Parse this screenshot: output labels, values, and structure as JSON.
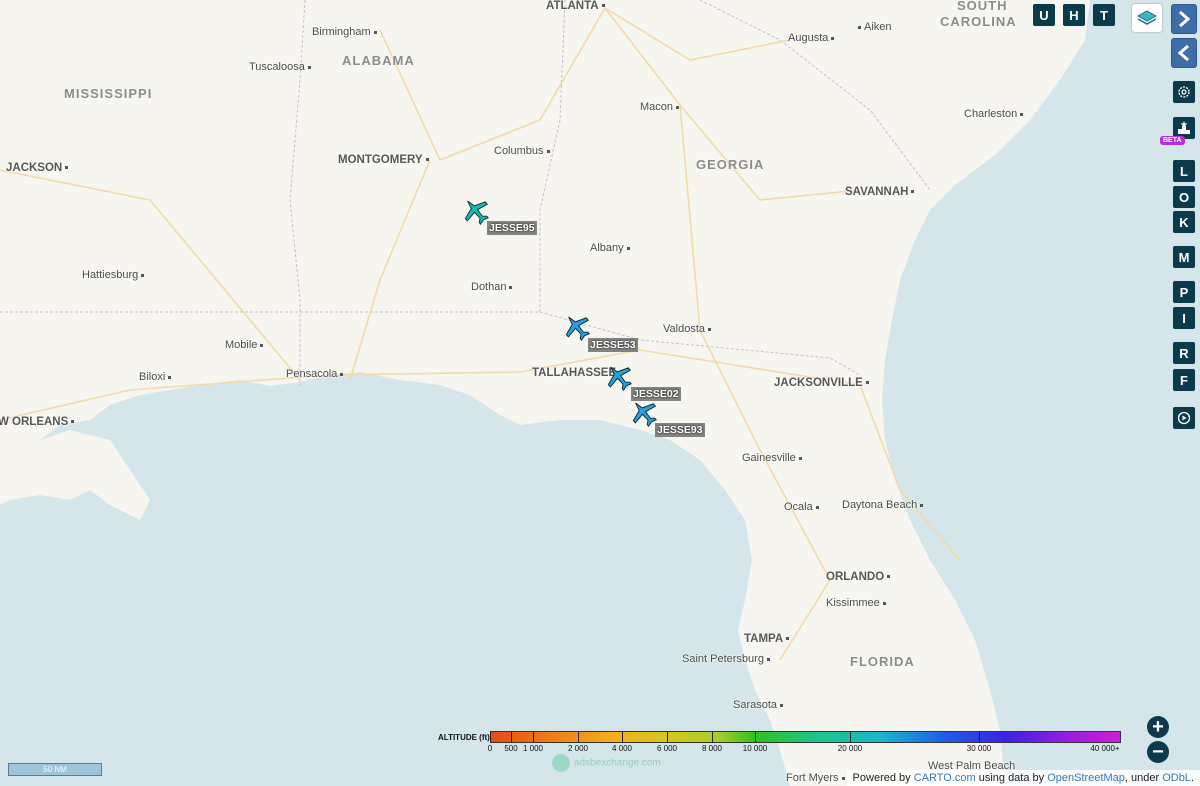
{
  "map": {
    "states": [
      {
        "name": "MISSISSIPPI"
      },
      {
        "name": "ALABAMA"
      },
      {
        "name": "GEORGIA"
      },
      {
        "name": "SOUTH"
      },
      {
        "name": "CAROLINA"
      },
      {
        "name": "FLORIDA"
      }
    ],
    "cities": [
      {
        "name": "ATLANTA",
        "major": true
      },
      {
        "name": "Birmingham"
      },
      {
        "name": "Tuscaloosa"
      },
      {
        "name": "Augusta"
      },
      {
        "name": "Aiken"
      },
      {
        "name": "Macon"
      },
      {
        "name": "Charleston"
      },
      {
        "name": "JACKSON",
        "major": true
      },
      {
        "name": "MONTGOMERY",
        "major": true
      },
      {
        "name": "Columbus"
      },
      {
        "name": "SAVANNAH",
        "major": true
      },
      {
        "name": "Albany"
      },
      {
        "name": "Hattiesburg"
      },
      {
        "name": "Dothan"
      },
      {
        "name": "Valdosta"
      },
      {
        "name": "Mobile"
      },
      {
        "name": "Pensacola"
      },
      {
        "name": "Biloxi"
      },
      {
        "name": "TALLAHASSEE",
        "major": true
      },
      {
        "name": "JACKSONVILLE",
        "major": true
      },
      {
        "name": "W ORLEANS",
        "major": true
      },
      {
        "name": "Gainesville"
      },
      {
        "name": "Ocala"
      },
      {
        "name": "Daytona Beach"
      },
      {
        "name": "ORLANDO",
        "major": true
      },
      {
        "name": "Kissimmee"
      },
      {
        "name": "TAMPA",
        "major": true
      },
      {
        "name": "Saint Petersburg"
      },
      {
        "name": "Sarasota"
      },
      {
        "name": "Fort Myers"
      },
      {
        "name": "West Palm Beach"
      }
    ]
  },
  "aircraft": [
    {
      "callsign": "JESSE95",
      "color": "#22b5b5"
    },
    {
      "callsign": "JESSE53",
      "color": "#2aa3dc"
    },
    {
      "callsign": "JESSE02",
      "color": "#2aa3dc"
    },
    {
      "callsign": "JESSE93",
      "color": "#2aa3dc"
    }
  ],
  "toolbar": {
    "top_buttons": [
      "U",
      "H",
      "T"
    ],
    "side_buttons": [
      "L",
      "O",
      "K",
      "M",
      "P",
      "I",
      "R",
      "F"
    ],
    "beta_label": "BETA"
  },
  "legend": {
    "title": "ALTITUDE (ft)",
    "ticks": [
      "0",
      "500",
      "1 000",
      "2 000",
      "4 000",
      "6 000",
      "8 000",
      "10 000",
      "20 000",
      "30 000",
      "40 000+"
    ]
  },
  "scale_label": "50 NM",
  "attribution": {
    "prefix": "Powered by ",
    "carto": "CARTO.com",
    "mid": " using data by ",
    "osm": "OpenStreetMap",
    "suffix": ", under ",
    "odbl": "ODbL",
    "end": "."
  },
  "watermark": "adsbexchange.com",
  "colors": {
    "button_bg": "#0b3b4a",
    "nav_bg": "#3d6ea8",
    "water": "#d4e6ea",
    "land": "#f7f5ef"
  }
}
